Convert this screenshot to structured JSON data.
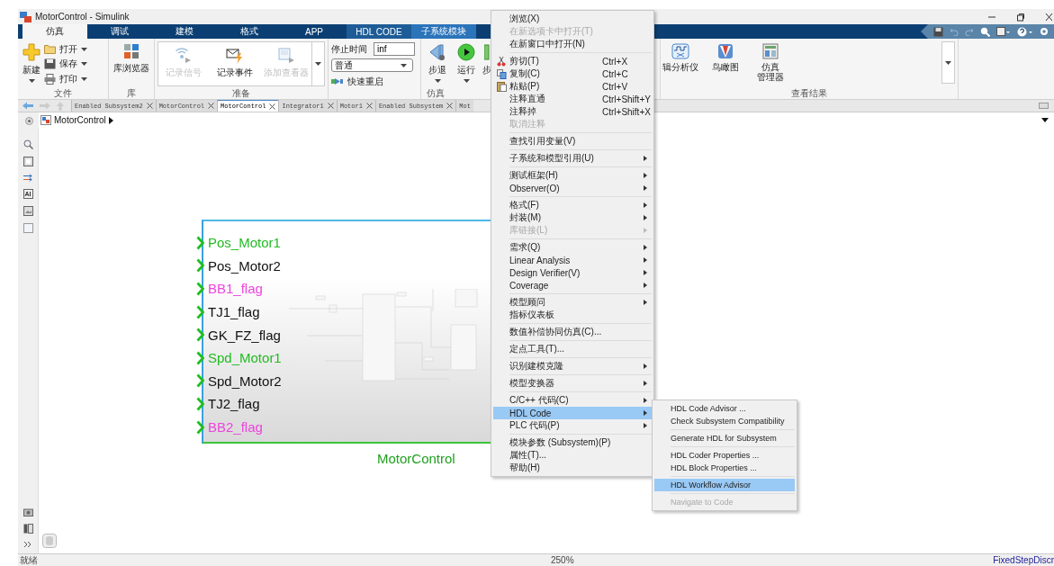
{
  "window": {
    "title": "MotorControl - Simulink"
  },
  "ribbon_tabs": [
    {
      "label": "仿真",
      "selected": true,
      "kind": "standard"
    },
    {
      "label": "调试",
      "selected": false,
      "kind": "standard"
    },
    {
      "label": "建模",
      "selected": false,
      "kind": "standard"
    },
    {
      "label": "格式",
      "selected": false,
      "kind": "standard"
    },
    {
      "label": "APP",
      "selected": false,
      "kind": "standard"
    },
    {
      "label": "HDL CODE",
      "selected": false,
      "kind": "contextual"
    },
    {
      "label": "子系统模块",
      "selected": false,
      "kind": "subsystem"
    }
  ],
  "file_group": {
    "label": "文件",
    "new": "新建",
    "open": "打开",
    "save": "保存",
    "print": "打印"
  },
  "library_group": {
    "label": "库",
    "browser": "库浏览器"
  },
  "prepare_group": {
    "label": "准备",
    "buttons": [
      {
        "label": "记录信号",
        "disabled": true
      },
      {
        "label": "记录事件",
        "disabled": false
      },
      {
        "label": "添加查看器",
        "disabled": true
      }
    ]
  },
  "stop_time": {
    "label": "停止时间",
    "value": "inf",
    "mode": "普通",
    "fast_restart": "快速重启"
  },
  "simulate_group": {
    "label": "仿真",
    "buttons": [
      "步退",
      "运行",
      "步"
    ]
  },
  "review_group": {
    "label": "查看结果",
    "buttons": [
      [
        "辑分析仪"
      ],
      [
        "鸟瞰图"
      ],
      [
        "仿真",
        "管理器"
      ]
    ]
  },
  "document_tabs": [
    {
      "label": "Enabled Subsystem2",
      "selected": false
    },
    {
      "label": "MotorControl",
      "selected": false
    },
    {
      "label": "MotorControl",
      "selected": true
    },
    {
      "label": "Integrator1",
      "selected": false
    },
    {
      "label": "Motor1",
      "selected": false
    },
    {
      "label": "Enabled Subsystem",
      "selected": false
    },
    {
      "label": "Mot",
      "selected": false
    }
  ],
  "breadcrumb": "MotorControl",
  "subsystem": {
    "name": "MotorControl",
    "ports": [
      {
        "label": "Pos_Motor1",
        "color": "#22bb22"
      },
      {
        "label": "Pos_Motor2",
        "color": "#111111"
      },
      {
        "label": "BB1_flag",
        "color": "#ee44dd"
      },
      {
        "label": "TJ1_flag",
        "color": "#111111"
      },
      {
        "label": "GK_FZ_flag",
        "color": "#111111"
      },
      {
        "label": "Spd_Motor1",
        "color": "#22bb22"
      },
      {
        "label": "Spd_Motor2",
        "color": "#111111"
      },
      {
        "label": "TJ2_flag",
        "color": "#111111"
      },
      {
        "label": "BB2_flag",
        "color": "#ee44dd"
      }
    ]
  },
  "context_menu": {
    "items": [
      {
        "kind": "item",
        "label": "浏览(X)",
        "disabled": false,
        "submenu": false,
        "selected": false
      },
      {
        "kind": "item",
        "label": "在新选项卡中打开(T)",
        "disabled": true,
        "submenu": false,
        "selected": false
      },
      {
        "kind": "item",
        "label": "在新窗口中打开(N)",
        "disabled": false,
        "submenu": false,
        "selected": false
      },
      {
        "kind": "separator"
      },
      {
        "kind": "item",
        "label": "剪切(T)",
        "shortcut": "Ctrl+X",
        "disabled": false,
        "submenu": false,
        "selected": false
      },
      {
        "kind": "item",
        "label": "复制(C)",
        "shortcut": "Ctrl+C",
        "disabled": false,
        "submenu": false,
        "selected": false
      },
      {
        "kind": "item",
        "label": "粘贴(P)",
        "shortcut": "Ctrl+V",
        "disabled": false,
        "submenu": false,
        "selected": false
      },
      {
        "kind": "item",
        "label": "注释直通",
        "shortcut": "Ctrl+Shift+Y",
        "disabled": false,
        "submenu": false,
        "selected": false
      },
      {
        "kind": "item",
        "label": "注释掉",
        "shortcut": "Ctrl+Shift+X",
        "disabled": false,
        "submenu": false,
        "selected": false
      },
      {
        "kind": "item",
        "label": "取消注释",
        "disabled": true,
        "submenu": false,
        "selected": false
      },
      {
        "kind": "separator"
      },
      {
        "kind": "item",
        "label": "查找引用变量(V)",
        "disabled": false,
        "submenu": false,
        "selected": false
      },
      {
        "kind": "separator"
      },
      {
        "kind": "item",
        "label": "子系统和模型引用(U)",
        "disabled": false,
        "submenu": true,
        "selected": false
      },
      {
        "kind": "separator"
      },
      {
        "kind": "item",
        "label": "测试框架(H)",
        "disabled": false,
        "submenu": true,
        "selected": false
      },
      {
        "kind": "item",
        "label": "Observer(O)",
        "disabled": false,
        "submenu": true,
        "selected": false
      },
      {
        "kind": "separator"
      },
      {
        "kind": "item",
        "label": "格式(F)",
        "disabled": false,
        "submenu": true,
        "selected": false
      },
      {
        "kind": "item",
        "label": "封装(M)",
        "disabled": false,
        "submenu": true,
        "selected": false
      },
      {
        "kind": "item",
        "label": "库链接(L)",
        "disabled": true,
        "submenu": true,
        "selected": false
      },
      {
        "kind": "separator"
      },
      {
        "kind": "item",
        "label": "需求(Q)",
        "disabled": false,
        "submenu": true,
        "selected": false
      },
      {
        "kind": "item",
        "label": "Linear Analysis",
        "disabled": false,
        "submenu": true,
        "selected": false
      },
      {
        "kind": "item",
        "label": "Design Verifier(V)",
        "disabled": false,
        "submenu": true,
        "selected": false
      },
      {
        "kind": "item",
        "label": "Coverage",
        "disabled": false,
        "submenu": true,
        "selected": false
      },
      {
        "kind": "separator"
      },
      {
        "kind": "item",
        "label": "模型顾问",
        "disabled": false,
        "submenu": true,
        "selected": false
      },
      {
        "kind": "item",
        "label": "指标仪表板",
        "disabled": false,
        "submenu": false,
        "selected": false
      },
      {
        "kind": "separator"
      },
      {
        "kind": "item",
        "label": "数值补偿协同仿真(C)...",
        "disabled": false,
        "submenu": false,
        "selected": false
      },
      {
        "kind": "separator"
      },
      {
        "kind": "item",
        "label": "定点工具(T)...",
        "disabled": false,
        "submenu": false,
        "selected": false
      },
      {
        "kind": "separator"
      },
      {
        "kind": "item",
        "label": "识别建模克隆",
        "disabled": false,
        "submenu": true,
        "selected": false
      },
      {
        "kind": "separator"
      },
      {
        "kind": "item",
        "label": "模型变换器",
        "disabled": false,
        "submenu": true,
        "selected": false
      },
      {
        "kind": "separator"
      },
      {
        "kind": "item",
        "label": "C/C++ 代码(C)",
        "disabled": false,
        "submenu": true,
        "selected": false
      },
      {
        "kind": "item",
        "label": "HDL Code",
        "disabled": false,
        "submenu": true,
        "selected": true
      },
      {
        "kind": "item",
        "label": "PLC 代码(P)",
        "disabled": false,
        "submenu": true,
        "selected": false
      },
      {
        "kind": "separator"
      },
      {
        "kind": "item",
        "label": "模块参数 (Subsystem)(P)",
        "disabled": false,
        "submenu": false,
        "selected": false
      },
      {
        "kind": "item",
        "label": "属性(T)...",
        "disabled": false,
        "submenu": false,
        "selected": false
      },
      {
        "kind": "item",
        "label": "帮助(H)",
        "disabled": false,
        "submenu": false,
        "selected": false
      }
    ]
  },
  "hdl_submenu": {
    "items": [
      {
        "kind": "item",
        "label": "HDL Code Advisor ...",
        "disabled": false,
        "selected": false
      },
      {
        "kind": "item",
        "label": "Check Subsystem Compatibility",
        "disabled": false,
        "selected": false
      },
      {
        "kind": "separator"
      },
      {
        "kind": "item",
        "label": "Generate HDL for Subsystem",
        "disabled": false,
        "selected": false
      },
      {
        "kind": "separator"
      },
      {
        "kind": "item",
        "label": "HDL Coder Properties ...",
        "disabled": false,
        "selected": false
      },
      {
        "kind": "item",
        "label": "HDL Block Properties ...",
        "disabled": false,
        "selected": false
      },
      {
        "kind": "separator"
      },
      {
        "kind": "item",
        "label": "HDL Workflow Advisor",
        "disabled": false,
        "selected": true
      },
      {
        "kind": "separator"
      },
      {
        "kind": "item",
        "label": "Navigate to Code",
        "disabled": true,
        "selected": false
      }
    ]
  },
  "status_bar": {
    "state": "就绪",
    "zoom": "250%",
    "solver": "FixedStepDiscr"
  }
}
